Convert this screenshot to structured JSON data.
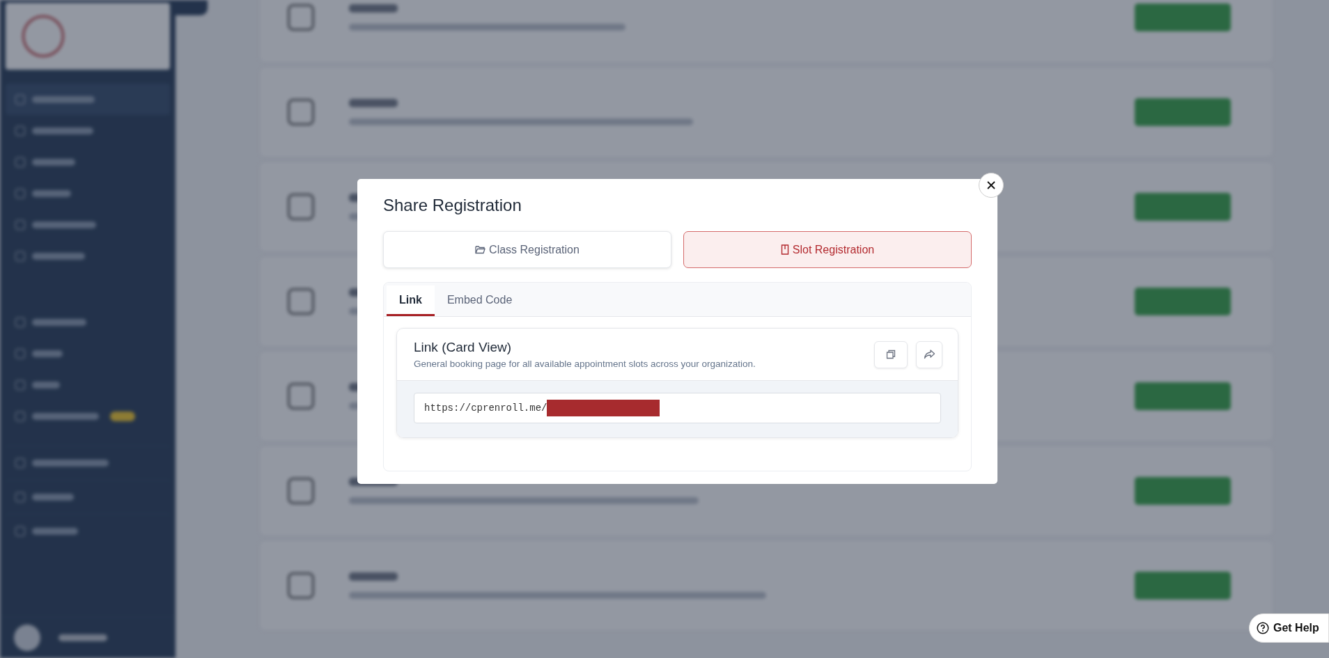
{
  "modal": {
    "title": "Share Registration",
    "modes": [
      {
        "label": "Class Registration",
        "kind": "folder",
        "selected": false
      },
      {
        "label": "Slot Registration",
        "kind": "book",
        "selected": true
      }
    ],
    "tabs": [
      {
        "label": "Link",
        "selected": true
      },
      {
        "label": "Embed Code",
        "selected": false
      }
    ],
    "link_card": {
      "title": "Link (Card View)",
      "description": "General booking page for all available appointment slots across your organization.",
      "url": "https://cprenroll.me/"
    }
  },
  "help_button": {
    "label": "Get Help"
  }
}
